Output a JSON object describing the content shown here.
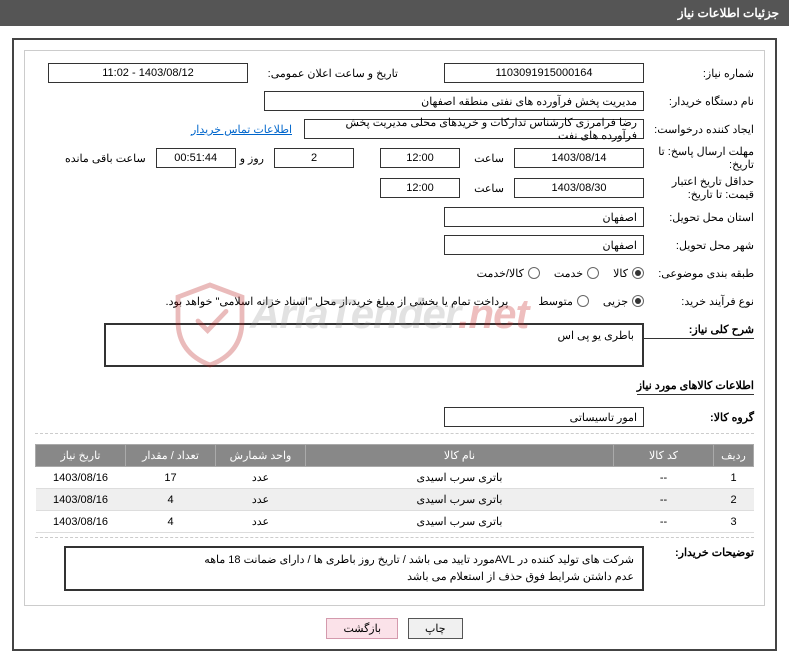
{
  "header": {
    "title": "جزئیات اطلاعات نیاز"
  },
  "form": {
    "need_num_lbl": "شماره نیاز:",
    "need_num": "1103091915000164",
    "announce_lbl": "تاریخ و ساعت اعلان عمومی:",
    "announce": "1403/08/12 - 11:02",
    "buyer_lbl": "نام دستگاه خریدار:",
    "buyer": "مدیریت پخش فرآورده های نفتی منطقه اصفهان",
    "requester_lbl": "ایجاد کننده درخواست:",
    "requester": "رضا فرامرزی کارشناس تدارکات و خریدهای محلی مدیریت پخش فرآورده های نفت",
    "contact_link": "اطلاعات تماس خریدار",
    "deadline_lbl": "مهلت ارسال پاسخ: تا تاریخ:",
    "deadline_date": "1403/08/14",
    "hour_lbl": "ساعت",
    "deadline_hour": "12:00",
    "days": "2",
    "day_word": "روز و",
    "remain_time": "00:51:44",
    "remain_lbl": "ساعت باقی مانده",
    "validity_lbl": "حداقل تاریخ اعتبار قیمت: تا تاریخ:",
    "validity_date": "1403/08/30",
    "validity_hour": "12:00",
    "province_lbl": "استان محل تحویل:",
    "province": "اصفهان",
    "city_lbl": "شهر محل تحویل:",
    "city": "اصفهان",
    "cat_lbl": "طبقه بندی موضوعی:",
    "cat_options": {
      "kala": "کالا",
      "khadamat": "خدمت",
      "kala_khadamat": "کالا/خدمت"
    },
    "process_lbl": "نوع فرآیند خرید:",
    "process_options": {
      "jozi": "جزیی",
      "motevaset": "متوسط"
    },
    "treasury_note": "پرداخت تمام یا بخشی از مبلغ خرید،از محل \"اسناد خزانه اسلامی\" خواهد بود.",
    "desc_lbl": "شرح کلی نیاز:",
    "desc": "باطری یو پی اس",
    "items_header": "اطلاعات کالاهای مورد نیاز",
    "group_lbl": "گروه کالا:",
    "group": "امور تاسیساتی",
    "buyer_notes_lbl": "توضیحات خریدار:",
    "buyer_notes_1": "شرکت های تولید کننده در AVLمورد تایید می باشد / تاریخ روز باطری ها / دارای ضمانت 18 ماهه",
    "buyer_notes_2": "عدم داشتن شرایط فوق حذف از استعلام می باشد"
  },
  "table": {
    "headers": {
      "row": "ردیف",
      "code": "کد کالا",
      "name": "نام کالا",
      "unit": "واحد شمارش",
      "qty": "تعداد / مقدار",
      "date": "تاریخ نیاز"
    },
    "rows": [
      {
        "row": "1",
        "code": "--",
        "name": "باتری سرب اسیدی",
        "unit": "عدد",
        "qty": "17",
        "date": "1403/08/16"
      },
      {
        "row": "2",
        "code": "--",
        "name": "باتری سرب اسیدی",
        "unit": "عدد",
        "qty": "4",
        "date": "1403/08/16"
      },
      {
        "row": "3",
        "code": "--",
        "name": "باتری سرب اسیدی",
        "unit": "عدد",
        "qty": "4",
        "date": "1403/08/16"
      }
    ]
  },
  "buttons": {
    "print": "چاپ",
    "back": "بازگشت"
  },
  "watermark": {
    "t1": "AriaTender",
    "t2": ".net"
  }
}
